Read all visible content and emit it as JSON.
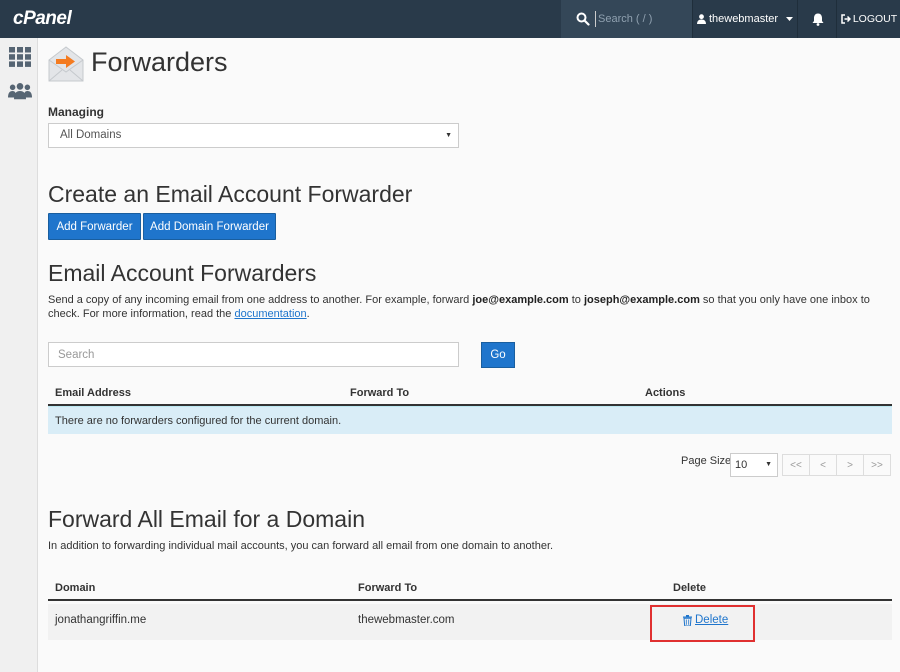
{
  "app": {
    "logo": "cPanel"
  },
  "topbar": {
    "search_placeholder": "Search ( / )",
    "username": "thewebmaster",
    "logout_label": "LOGOUT"
  },
  "page": {
    "title": "Forwarders",
    "managing_label": "Managing",
    "managing_value": "All Domains"
  },
  "create": {
    "heading": "Create an Email Account Forwarder",
    "add_forwarder": "Add Forwarder",
    "add_domain_forwarder": "Add Domain Forwarder"
  },
  "account_forwarders": {
    "heading": "Email Account Forwarders",
    "desc_1": "Send a copy of any incoming email from one address to another. For example, forward ",
    "example_from": "joe@example.com",
    "desc_2": " to ",
    "example_to": "joseph@example.com",
    "desc_3": " so that you only have one inbox to check. For more information, read the ",
    "doc_link": "documentation",
    "desc_4": ".",
    "search_placeholder": "Search",
    "go_label": "Go",
    "columns": [
      "Email Address",
      "Forward To",
      "Actions"
    ],
    "empty_message": "There are no forwarders configured for the current domain.",
    "page_size_label": "Page Size",
    "page_size_value": "10",
    "pager": [
      "<<",
      "<",
      ">",
      ">>"
    ]
  },
  "domain_forwarders": {
    "heading": "Forward All Email for a Domain",
    "desc": "In addition to forwarding individual mail accounts, you can forward all email from one domain to another.",
    "columns": [
      "Domain",
      "Forward To",
      "Delete"
    ],
    "rows": [
      {
        "domain": "jonathangriffin.me",
        "forward_to": "thewebmaster.com",
        "action": "Delete"
      }
    ]
  },
  "colors": {
    "topbar": "#293a4a",
    "primary": "#1f75cc",
    "info_row": "#d9edf7",
    "highlight": "#e03030",
    "logo_accent": "#f47b20"
  },
  "icons": [
    "search-icon",
    "user-icon",
    "caret-down-icon",
    "bell-icon",
    "logout-icon",
    "grid-icon",
    "users-icon",
    "email-forward-icon",
    "trash-icon"
  ]
}
